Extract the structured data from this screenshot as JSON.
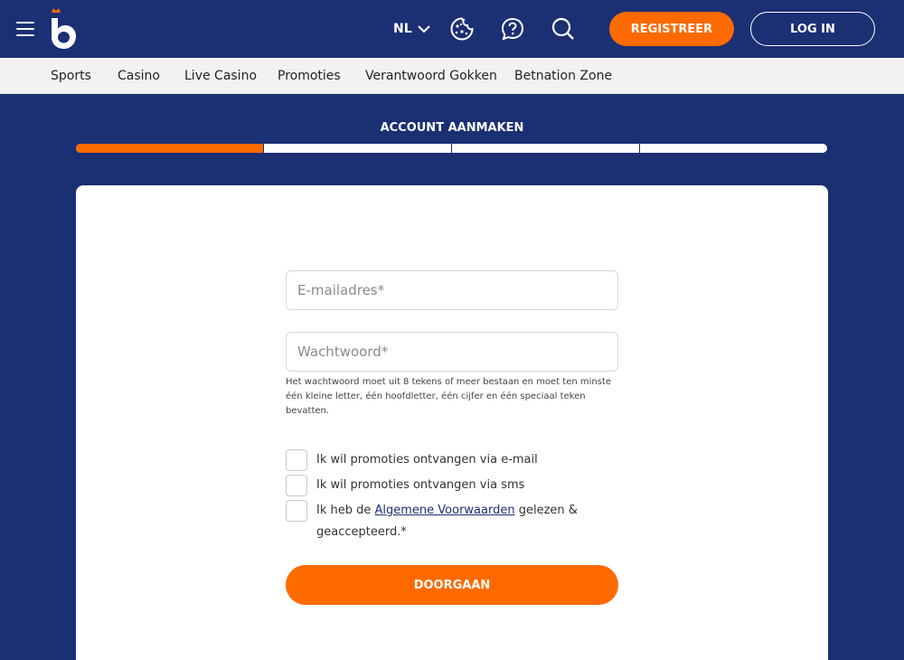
{
  "header": {
    "language": "NL",
    "register_label": "REGISTREER",
    "login_label": "LOG IN",
    "icons": [
      "menu-icon",
      "logo",
      "chevron-down-icon",
      "cookie-icon",
      "help-icon",
      "search-icon"
    ]
  },
  "subnav": {
    "items": [
      "Sports",
      "Casino",
      "Live Casino",
      "Promoties",
      "Verantwoord Gokken",
      "Betnation Zone"
    ]
  },
  "signup": {
    "step_title": "ACCOUNT AANMAKEN",
    "progress": {
      "current_step": 1,
      "total_steps": 4
    },
    "email_placeholder": "E-mailadres*",
    "password_placeholder": "Wachtwoord*",
    "password_hint": "Het wachtwoord moet uit 8 tekens of meer bestaan en moet ten minste één kleine letter, één hoofdletter, één cijfer en één speciaal teken bevatten.",
    "checkbox_email": "Ik wil promoties ontvangen via e-mail",
    "checkbox_sms": "Ik wil promoties ontvangen via sms",
    "terms_prefix": "Ik heb de ",
    "terms_link": "Algemene Voorwaarden",
    "terms_suffix": " gelezen & geaccepteerd.*",
    "continue_label": "DOORGAAN"
  },
  "colors": {
    "navy": "#1b2f73",
    "orange": "#ff6a00",
    "white": "#ffffff"
  }
}
